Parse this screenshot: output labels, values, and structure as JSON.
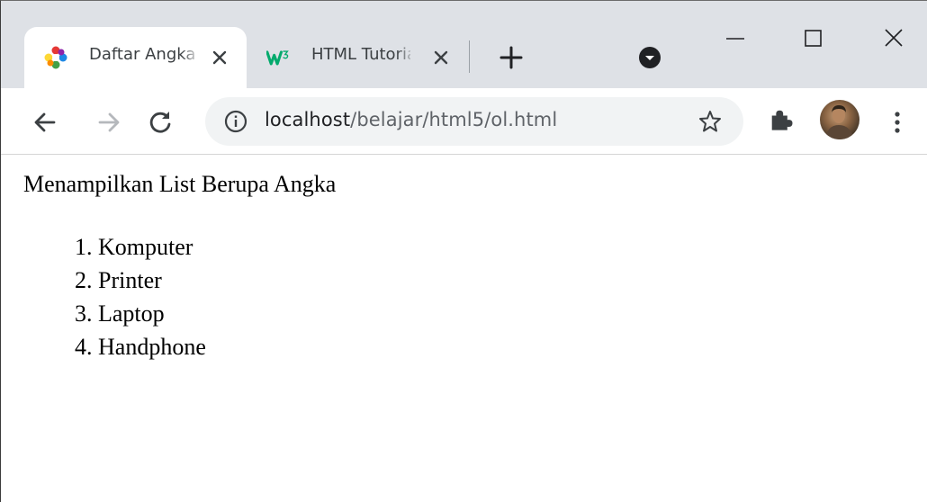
{
  "browser": {
    "tabs": [
      {
        "title": "Daftar Angka",
        "favicon": "puzzle-flower-icon",
        "active": true
      },
      {
        "title": "HTML Tutorial",
        "favicon": "w3schools-icon",
        "active": false
      }
    ],
    "address_bar": {
      "host": "localhost",
      "path": "/belajar/html5/ol.html"
    }
  },
  "page": {
    "heading": "Menampilkan List Berupa Angka",
    "list": [
      "Komputer",
      "Printer",
      "Laptop",
      "Handphone"
    ]
  },
  "colors": {
    "titlebar": "#dee1e6",
    "omnibox": "#f1f3f4",
    "w3_green": "#04aa6d"
  }
}
